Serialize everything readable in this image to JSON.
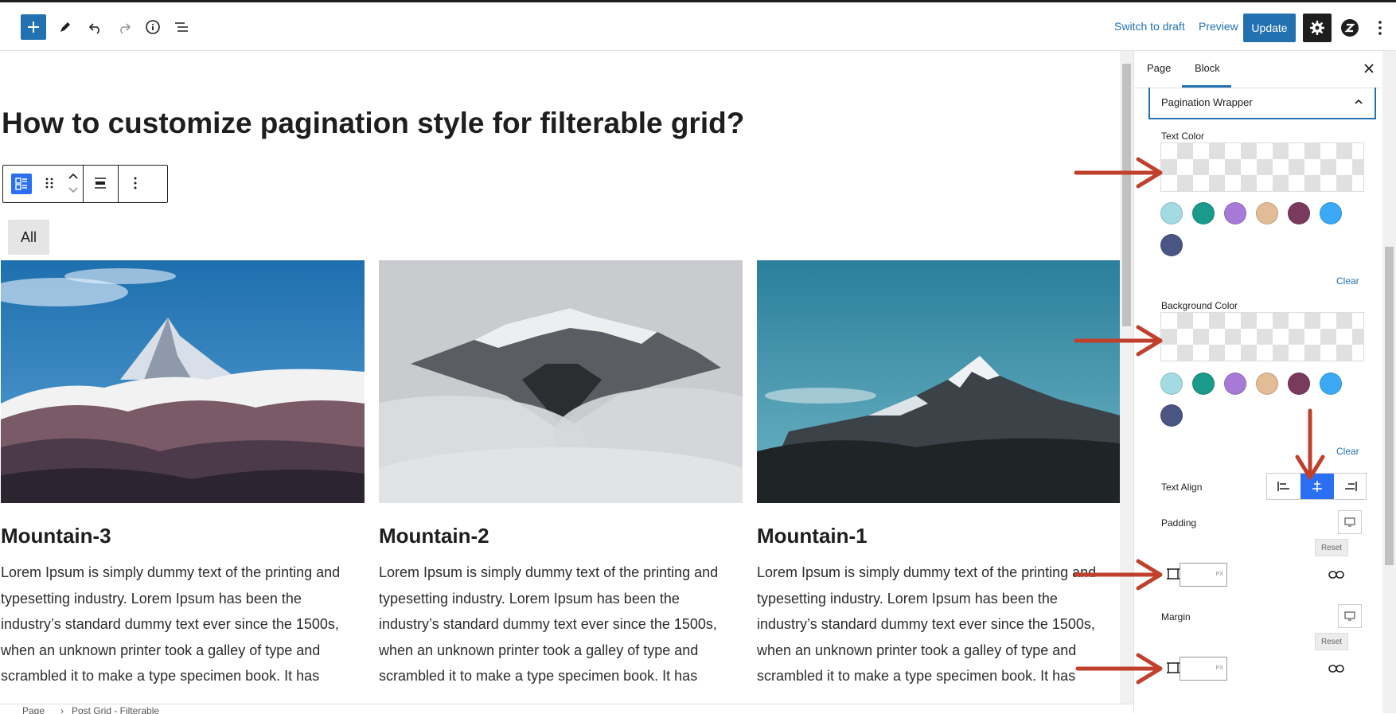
{
  "toolbar": {
    "switch_to_draft": "Switch to draft",
    "preview": "Preview",
    "update": "Update"
  },
  "editor": {
    "title": "How to customize pagination style for filterable grid?",
    "filter_all": "All",
    "posts": [
      {
        "title": "Mountain-3",
        "excerpt": "Lorem Ipsum is simply dummy text of the printing and typesetting industry. Lorem Ipsum has been the industry’s standard dummy text ever since the 1500s, when an unknown printer took a galley of type and scrambled it to make a type specimen book. It has"
      },
      {
        "title": "Mountain-2",
        "excerpt": "Lorem Ipsum is simply dummy text of the printing and typesetting industry. Lorem Ipsum has been the industry’s standard dummy text ever since the 1500s, when an unknown printer took a galley of type and scrambled it to make a type specimen book. It has"
      },
      {
        "title": "Mountain-1",
        "excerpt": "Lorem Ipsum is simply dummy text of the printing and typesetting industry. Lorem Ipsum has been the industry’s standard dummy text ever since the 1500s, when an unknown printer took a galley of type and scrambled it to make a type specimen book. It has"
      }
    ]
  },
  "breadcrumb": [
    "Page",
    "Post Grid - Filterable"
  ],
  "sidebar": {
    "tabs": [
      "Page",
      "Block"
    ],
    "active_tab": "Block",
    "panel_title": "Pagination Wrapper",
    "text_color_label": "Text Color",
    "background_color_label": "Background Color",
    "clear_label": "Clear",
    "text_align_label": "Text Align",
    "padding_label": "Padding",
    "margin_label": "Margin",
    "reset_label": "Reset",
    "unit": "PX",
    "palette": [
      "#a4dbe3",
      "#1a9a8a",
      "#a67ad6",
      "#e2bc96",
      "#7a3a5e",
      "#3ba9f6",
      "#4a5584"
    ],
    "active_align": "center"
  },
  "colors": {
    "accent": "#2271b1",
    "align_active": "#2b6ff3",
    "annotation_arrow": "#c0402c"
  }
}
